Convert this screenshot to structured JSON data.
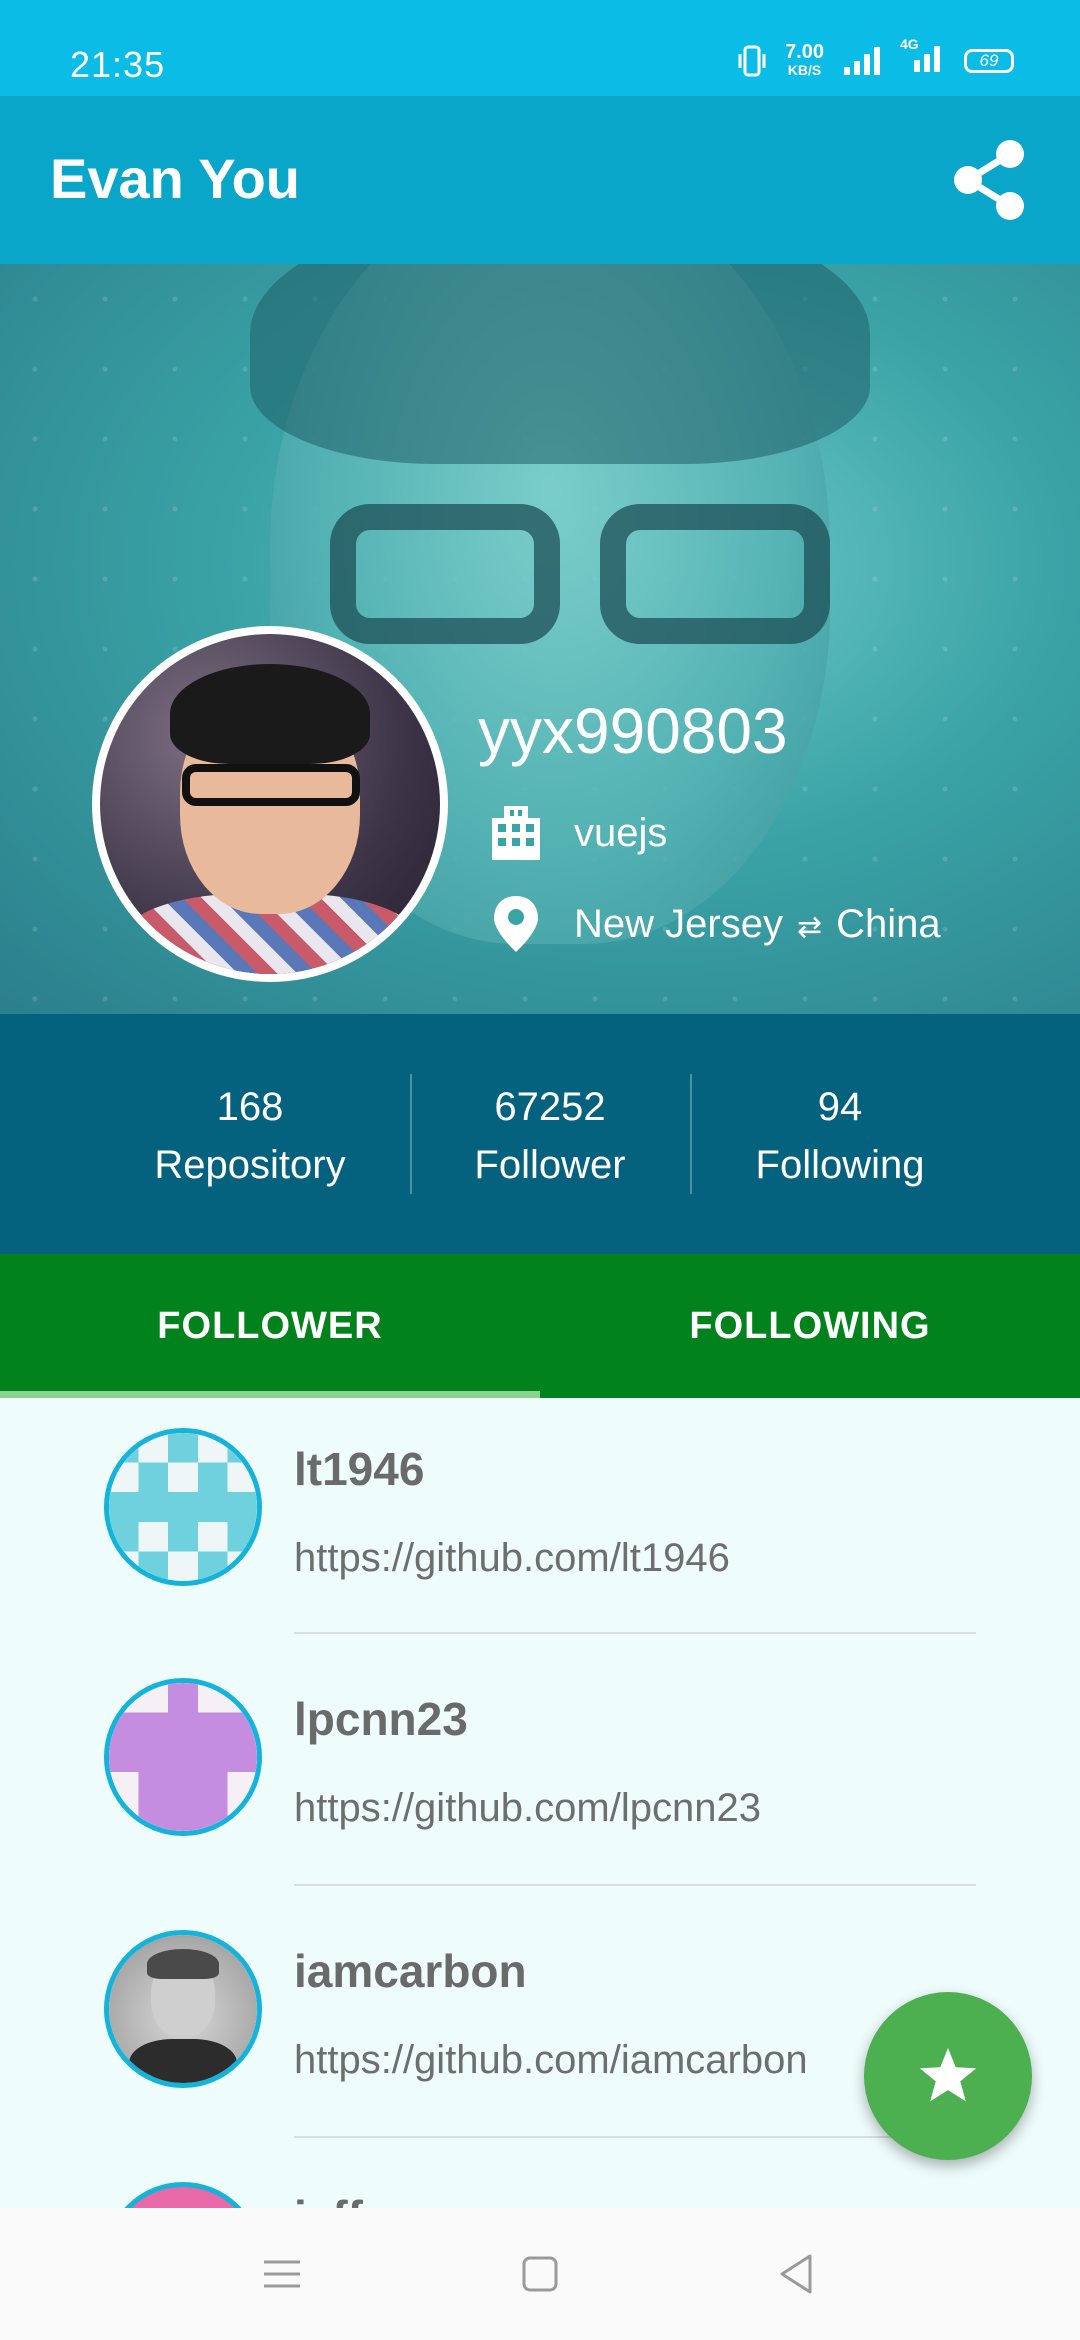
{
  "status_bar": {
    "time": "21:35",
    "net_speed": "7.00",
    "net_unit": "KB/S",
    "network": "4G",
    "battery": "69"
  },
  "app_bar": {
    "title": "Evan You",
    "share_icon": "share-icon"
  },
  "profile": {
    "username": "yyx990803",
    "company": "vuejs",
    "location_from": "New Jersey",
    "location_arrow": "⇄",
    "location_to": "China"
  },
  "stats": {
    "repository_count": "168",
    "repository_label": "Repository",
    "follower_count": "67252",
    "follower_label": "Follower",
    "following_count": "94",
    "following_label": "Following"
  },
  "tabs": [
    {
      "label": "FOLLOWER",
      "selected": true
    },
    {
      "label": "FOLLOWING",
      "selected": false
    }
  ],
  "list": {
    "items": [
      {
        "name": "lt1946",
        "url": "https://github.com/lt1946"
      },
      {
        "name": "lpcnn23",
        "url": "https://github.com/lpcnn23"
      },
      {
        "name": "iamcarbon",
        "url": "https://github.com/iamcarbon"
      },
      {
        "name": "jeffyu",
        "url": ""
      }
    ]
  },
  "fab": {
    "icon": "star-icon"
  },
  "colors": {
    "status_bar": "#0bbde6",
    "app_bar": "#0aa6c9",
    "stats_bg": "#04627f",
    "tabs_bg": "#02821c",
    "fab": "#4caf50",
    "avatar_border": "#14b3d9"
  }
}
